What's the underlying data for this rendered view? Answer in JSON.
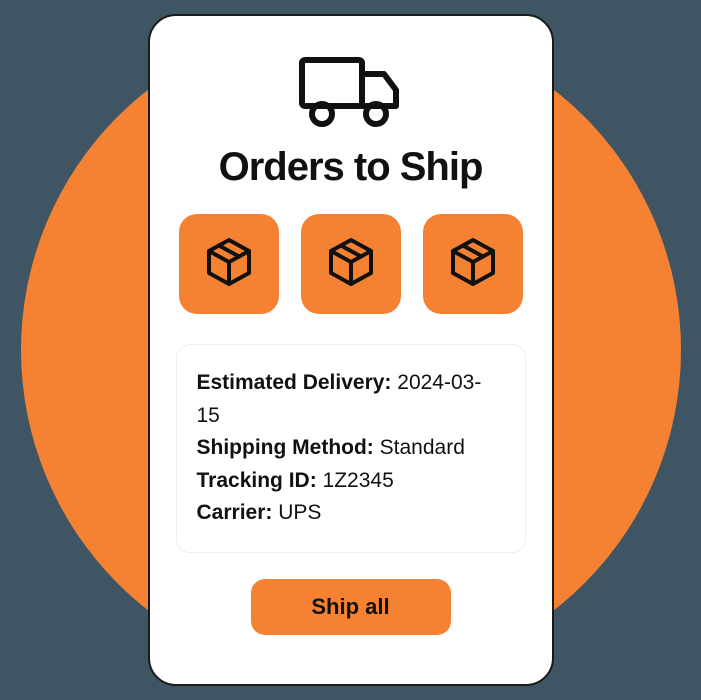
{
  "card": {
    "title": "Orders to Ship",
    "ship_button_label": "Ship all"
  },
  "packages": [
    {
      "icon": "package-icon"
    },
    {
      "icon": "package-icon"
    },
    {
      "icon": "package-icon"
    }
  ],
  "details": {
    "estimated_delivery_label": "Estimated Delivery:",
    "estimated_delivery_value": "2024-03-15",
    "shipping_method_label": "Shipping Method:",
    "shipping_method_value": "Standard",
    "tracking_id_label": "Tracking ID:",
    "tracking_id_value": "1Z2345",
    "carrier_label": "Carrier:",
    "carrier_value": "UPS"
  },
  "colors": {
    "accent": "#f58232",
    "background": "#405563"
  }
}
